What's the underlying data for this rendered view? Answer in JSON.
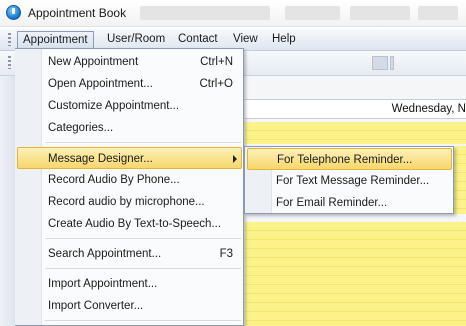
{
  "window": {
    "title": "Appointment Book",
    "icon": "app-clock-icon"
  },
  "menubar": {
    "items": [
      {
        "label": "Appointment",
        "open": true
      },
      {
        "label": "User/Room"
      },
      {
        "label": "Contact"
      },
      {
        "label": "View"
      },
      {
        "label": "Help"
      }
    ]
  },
  "calendar": {
    "day_header": "Wednesday, N"
  },
  "appointment_menu": {
    "items": [
      {
        "label": "New Appointment",
        "shortcut": "Ctrl+N"
      },
      {
        "label": "Open Appointment...",
        "shortcut": "Ctrl+O"
      },
      {
        "label": "Customize Appointment..."
      },
      {
        "label": "Categories..."
      },
      {
        "label": "Message Designer...",
        "highlighted": true,
        "has_submenu": true
      },
      {
        "label": "Record Audio By Phone..."
      },
      {
        "label": "Record audio by microphone..."
      },
      {
        "label": "Create Audio By Text-to-Speech..."
      },
      {
        "label": "Search Appointment...",
        "shortcut": "F3"
      },
      {
        "label": "Import Appointment..."
      },
      {
        "label": "Import Converter..."
      }
    ]
  },
  "message_designer_submenu": {
    "items": [
      {
        "label": "For Telephone Reminder...",
        "highlighted": true
      },
      {
        "label": "For Text Message Reminder..."
      },
      {
        "label": "For Email Reminder..."
      }
    ]
  },
  "colors": {
    "highlight": "#f6d76c",
    "calendar_busy": "#fbf389",
    "accent_border": "#8a9bb3"
  }
}
